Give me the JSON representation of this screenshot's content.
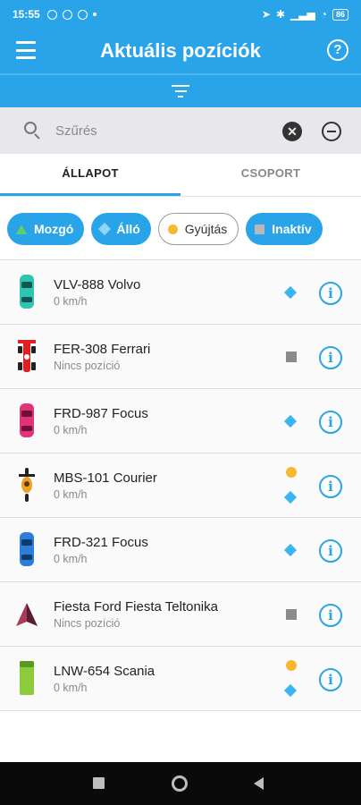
{
  "status_bar": {
    "time": "15:55",
    "icons": [
      "alarm-icon",
      "location-icon",
      "target-icon",
      "dot-icon",
      "location-arrow-icon",
      "bluetooth-icon",
      "signal-icon",
      "wifi-icon"
    ],
    "battery": "86"
  },
  "app_bar": {
    "title": "Aktuális pozíciók",
    "menu_icon": "hamburger-menu-icon",
    "help_icon": "question-circle-icon"
  },
  "filter_toggle": {
    "icon": "filter-lines-icon"
  },
  "search": {
    "placeholder": "Szűrés",
    "value": ""
  },
  "tabs": [
    {
      "label": "ÁLLAPOT",
      "active": true
    },
    {
      "label": "CSOPORT",
      "active": false
    }
  ],
  "status_chips": [
    {
      "label": "Mozgó",
      "icon": "triangle-icon",
      "color": "#5fd068",
      "selected": true
    },
    {
      "label": "Álló",
      "icon": "diamond-icon",
      "color": "#8fd5fb",
      "selected": true
    },
    {
      "label": "Gyújtás",
      "icon": "dot-icon",
      "color": "#f8b830",
      "selected": false
    },
    {
      "label": "Inaktív",
      "icon": "square-icon",
      "color": "#b8b8b8",
      "selected": true
    }
  ],
  "vehicles": [
    {
      "name": "VLV-888 Volvo",
      "subtitle": "0 km/h",
      "vehicle_icon": "car-top-icon",
      "color": "#2ec4b0",
      "status": [
        "diamond"
      ]
    },
    {
      "name": "FER-308 Ferrari",
      "subtitle": "Nincs pozíció",
      "vehicle_icon": "race-car-icon",
      "color": "#e02020",
      "status": [
        "square"
      ]
    },
    {
      "name": "FRD-987 Focus",
      "subtitle": "0 km/h",
      "vehicle_icon": "car-top-icon",
      "color": "#e0337a",
      "status": [
        "diamond"
      ]
    },
    {
      "name": "MBS-101 Courier",
      "subtitle": "0 km/h",
      "vehicle_icon": "motorcycle-icon",
      "color": "#f0a020",
      "status": [
        "dot",
        "diamond"
      ]
    },
    {
      "name": "FRD-321 Focus",
      "subtitle": "0 km/h",
      "vehicle_icon": "car-top-icon",
      "color": "#2c7ed8",
      "status": [
        "diamond"
      ]
    },
    {
      "name": "Fiesta Ford Fiesta Teltonika",
      "subtitle": "Nincs pozíció",
      "vehicle_icon": "pyramid-marker-icon",
      "color": "#7a2a40",
      "status": [
        "square"
      ]
    },
    {
      "name": "LNW-654 Scania",
      "subtitle": "0 km/h",
      "vehicle_icon": "truck-top-icon",
      "color": "#8ccc3c",
      "status": [
        "dot",
        "diamond"
      ]
    }
  ],
  "info_icon": "info-circle-icon",
  "nav_bar": {
    "icons": [
      "recent-apps-icon",
      "home-icon",
      "back-icon"
    ]
  }
}
